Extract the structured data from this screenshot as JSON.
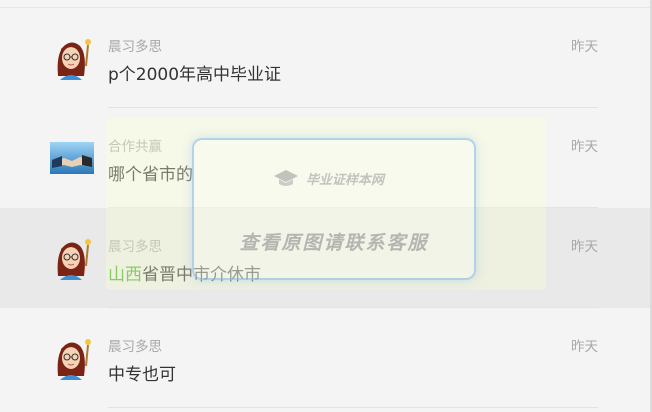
{
  "messages": [
    {
      "sender": "晨习多思",
      "time": "昨天",
      "text": "p个2000年高中毕业证",
      "avatar": "woman-avatar-icon"
    },
    {
      "sender": "合作共赢",
      "time": "昨天",
      "text": "哪个省市的",
      "avatar": "handshake-avatar-icon"
    },
    {
      "sender": "晨习多思",
      "time": "昨天",
      "text_prefix": "山西",
      "text_rest": "省晋中市介休市",
      "avatar": "woman-avatar-icon"
    },
    {
      "sender": "晨习多思",
      "time": "昨天",
      "text": "中专也可",
      "avatar": "woman-avatar-icon"
    }
  ],
  "watermark": {
    "logo_text": "毕业证样本网",
    "text": "查看原图请联系客服"
  },
  "colors": {
    "location": "#4caf2a",
    "muted": "#a8a8a8",
    "body_text": "#333333",
    "highlight_row": "#e9e9e9"
  }
}
